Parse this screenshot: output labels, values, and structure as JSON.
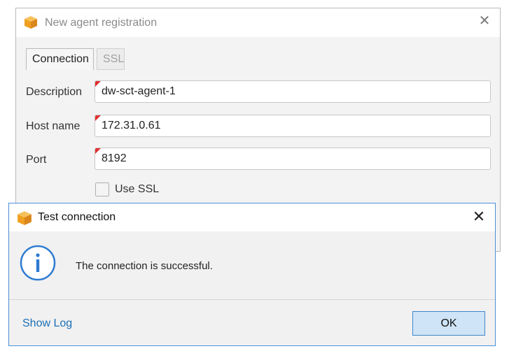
{
  "registration_dialog": {
    "title": "New agent registration",
    "tabs": [
      {
        "label": "Connection",
        "active": true
      },
      {
        "label": "SSL",
        "active": false
      }
    ],
    "fields": {
      "description": {
        "label": "Description",
        "value": "dw-sct-agent-1"
      },
      "host_name": {
        "label": "Host name",
        "value": "172.31.0.61"
      },
      "port": {
        "label": "Port",
        "value": "8192"
      }
    },
    "use_ssl": {
      "label": "Use SSL",
      "checked": false
    }
  },
  "test_dialog": {
    "title": "Test connection",
    "message": "The connection is successful.",
    "show_log_label": "Show Log",
    "ok_label": "OK"
  },
  "colors": {
    "accent_blue": "#4a8ed8",
    "link_blue": "#1a6fb6",
    "required_marker": "#e03030",
    "app_icon_orange": "#f5a623"
  },
  "icons": {
    "app": "box-icon",
    "info": "info-icon",
    "close": "close-icon"
  }
}
